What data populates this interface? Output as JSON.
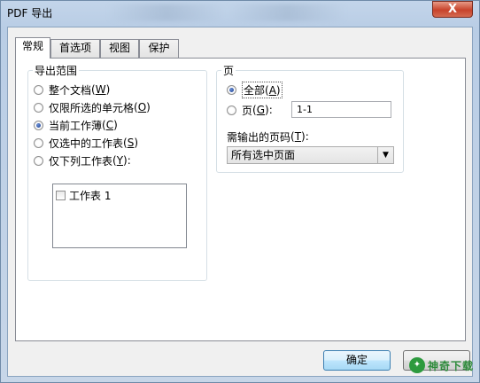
{
  "window": {
    "title": "PDF 导出",
    "close_label": "X"
  },
  "tabs": [
    {
      "label": "常规",
      "active": true
    },
    {
      "label": "首选项",
      "active": false
    },
    {
      "label": "视图",
      "active": false
    },
    {
      "label": "保护",
      "active": false
    }
  ],
  "export_range": {
    "legend": "导出范围",
    "options": [
      {
        "label": "整个文档",
        "key": "W",
        "checked": false
      },
      {
        "label": "仅限所选的单元格",
        "key": "O",
        "checked": false
      },
      {
        "label": "当前工作薄",
        "key": "C",
        "checked": true
      },
      {
        "label": "仅选中的工作表",
        "key": "S",
        "checked": false
      },
      {
        "label": "仅下列工作表",
        "key": "Y",
        "checked": false,
        "suffix": ":"
      }
    ],
    "sheet_list": [
      {
        "label": "工作表 1",
        "checked": false
      }
    ]
  },
  "pages": {
    "legend": "页",
    "all_label": "全部",
    "all_key": "A",
    "all_checked": true,
    "page_label": "页",
    "page_key": "G",
    "page_suffix": ":",
    "page_value": "1-1",
    "output_label": "需输出的页码",
    "output_key": "T",
    "output_suffix": ":",
    "output_selected": "所有选中页面"
  },
  "buttons": {
    "ok_label": "确定",
    "cancel_label": ""
  },
  "watermark": {
    "text": "神奇下载"
  },
  "colors": {
    "accent": "#3c7fb1",
    "close": "#c7432b"
  }
}
